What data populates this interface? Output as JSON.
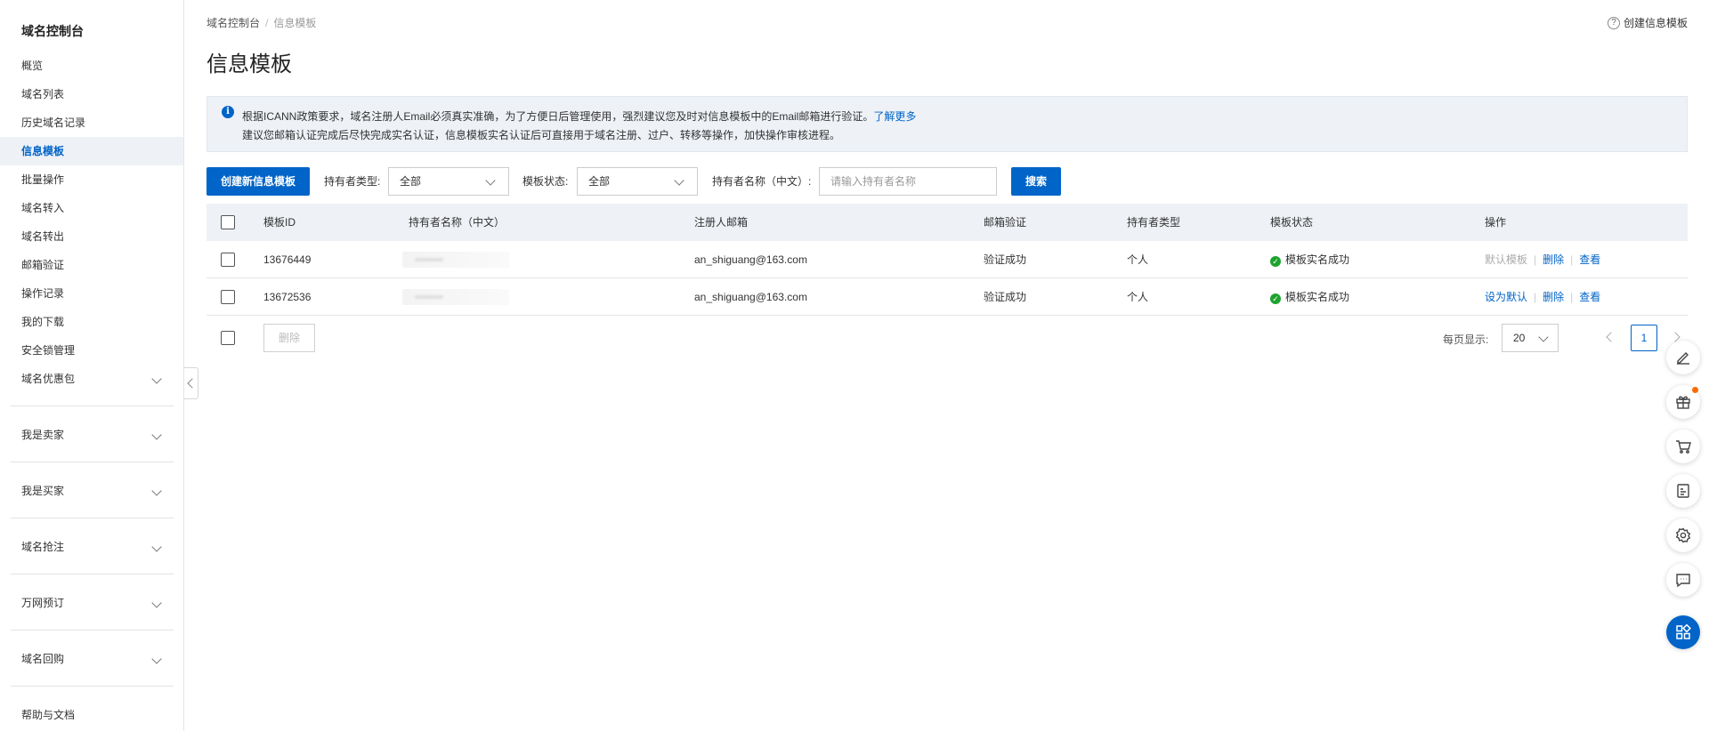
{
  "sidebar": {
    "title": "域名控制台",
    "items": [
      {
        "label": "概览"
      },
      {
        "label": "域名列表"
      },
      {
        "label": "历史域名记录"
      },
      {
        "label": "信息模板"
      },
      {
        "label": "批量操作"
      },
      {
        "label": "域名转入"
      },
      {
        "label": "域名转出"
      },
      {
        "label": "邮箱验证"
      },
      {
        "label": "操作记录"
      },
      {
        "label": "我的下载"
      },
      {
        "label": "安全锁管理"
      }
    ],
    "groups": [
      {
        "label": "域名优惠包"
      },
      {
        "label": "我是卖家"
      },
      {
        "label": "我是买家"
      },
      {
        "label": "域名抢注"
      },
      {
        "label": "万网预订"
      },
      {
        "label": "域名回购"
      }
    ],
    "help_link": "帮助与文档",
    "active_index": 3
  },
  "breadcrumb": {
    "root": "域名控制台",
    "separator": "/",
    "current": "信息模板"
  },
  "header": {
    "help_text": "创建信息模板",
    "title": "信息模板"
  },
  "notice": {
    "line1": "根据ICANN政策要求，域名注册人Email必须真实准确，为了方便日后管理使用，强烈建议您及时对信息模板中的Email邮箱进行验证。",
    "learn_more": "了解更多",
    "line2": "建议您邮箱认证完成后尽快完成实名认证，信息模板实名认证后可直接用于域名注册、过户、转移等操作，加快操作审核进程。"
  },
  "toolbar": {
    "create_label": "创建新信息模板",
    "holder_type_label": "持有者类型:",
    "holder_type_value": "全部",
    "template_status_label": "模板状态:",
    "template_status_value": "全部",
    "holder_name_label": "持有者名称（中文）:",
    "holder_name_placeholder": "请输入持有者名称",
    "search_label": "搜索"
  },
  "table": {
    "columns": [
      "模板ID",
      "持有者名称（中文）",
      "注册人邮箱",
      "邮箱验证",
      "持有者类型",
      "模板状态",
      "操作"
    ],
    "rows": [
      {
        "id": "13676449",
        "email": "an_shiguang@163.com",
        "email_verify": "验证成功",
        "holder_type": "个人",
        "status": "模板实名成功",
        "op_default": "默认模板",
        "op_delete": "删除",
        "op_view": "查看"
      },
      {
        "id": "13672536",
        "email": "an_shiguang@163.com",
        "email_verify": "验证成功",
        "holder_type": "个人",
        "status": "模板实名成功",
        "op_default": "设为默认",
        "op_delete": "删除",
        "op_view": "查看"
      }
    ]
  },
  "footer": {
    "delete_label": "删除",
    "per_page_label": "每页显示:",
    "per_page_value": "20",
    "current_page": "1"
  },
  "colors": {
    "accent": "#0064c8",
    "success": "#1fa32f",
    "badge": "#ff6a00"
  },
  "float_tools": [
    "edit-icon",
    "gift-icon",
    "cart-icon",
    "api-icon",
    "settings-icon",
    "chat-icon",
    "apps-icon"
  ]
}
